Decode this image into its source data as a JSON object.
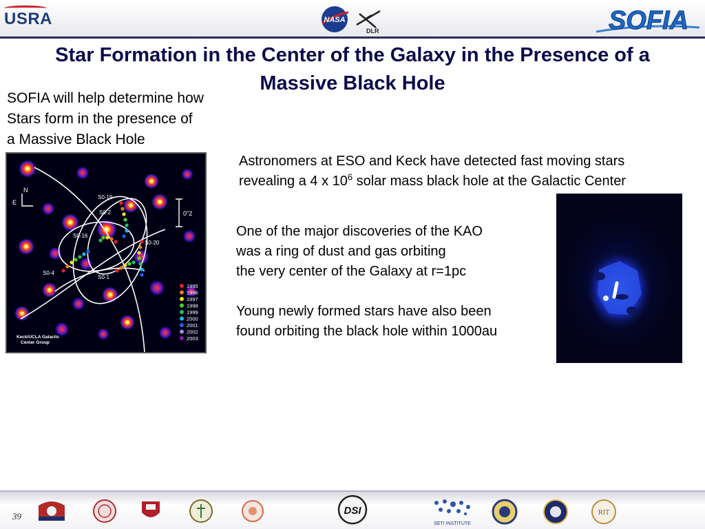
{
  "header": {
    "usra_logo_text": "USRA",
    "nasa_logo_text": "NASA",
    "dlr_logo_text": "DLR",
    "sofia_logo_text": "SOFIA"
  },
  "slide": {
    "title": "Star Formation in the Center of the Galaxy in the Presence of a Massive Black Hole",
    "intro": "SOFIA will help determine how\n Stars form in the presence of\na Massive Black Hole",
    "eso_text_before": "Astronomers at ESO and Keck have detected fast moving stars revealing a 4 x 10",
    "eso_superscript": "6",
    "eso_text_after": " solar mass black hole at the Galactic Center",
    "kao_text": "One of the major discoveries of the KAO\nwas a ring of dust and gas orbiting\nthe very center of the Galaxy at r=1pc",
    "young_text": "Young newly formed stars have also been\nfound orbiting the black hole within 1000au"
  },
  "figure": {
    "star_labels": [
      "S0-19",
      "S0-2",
      "S0-16",
      "S0-20",
      "S0-4",
      "S0-1"
    ],
    "compass_n": "N",
    "compass_e": "E",
    "scale_label": "0\"2",
    "legend_years": [
      "1995",
      "1996",
      "1997",
      "1998",
      "1999",
      "2000",
      "2001",
      "2002",
      "2003"
    ],
    "legend_colors": [
      "#e0202a",
      "#f07818",
      "#f0e020",
      "#50d020",
      "#20c060",
      "#20b8e8",
      "#2060e8",
      "#a888e8",
      "#8020a0"
    ],
    "credit": "Keck/UCLA Galactic\nCenter Group"
  },
  "footer": {
    "page_number": "39",
    "dsi_logo_text": "DSI",
    "seti_logo_text": "SETI INSTITUTE",
    "rit_logo_text": "RIT"
  }
}
